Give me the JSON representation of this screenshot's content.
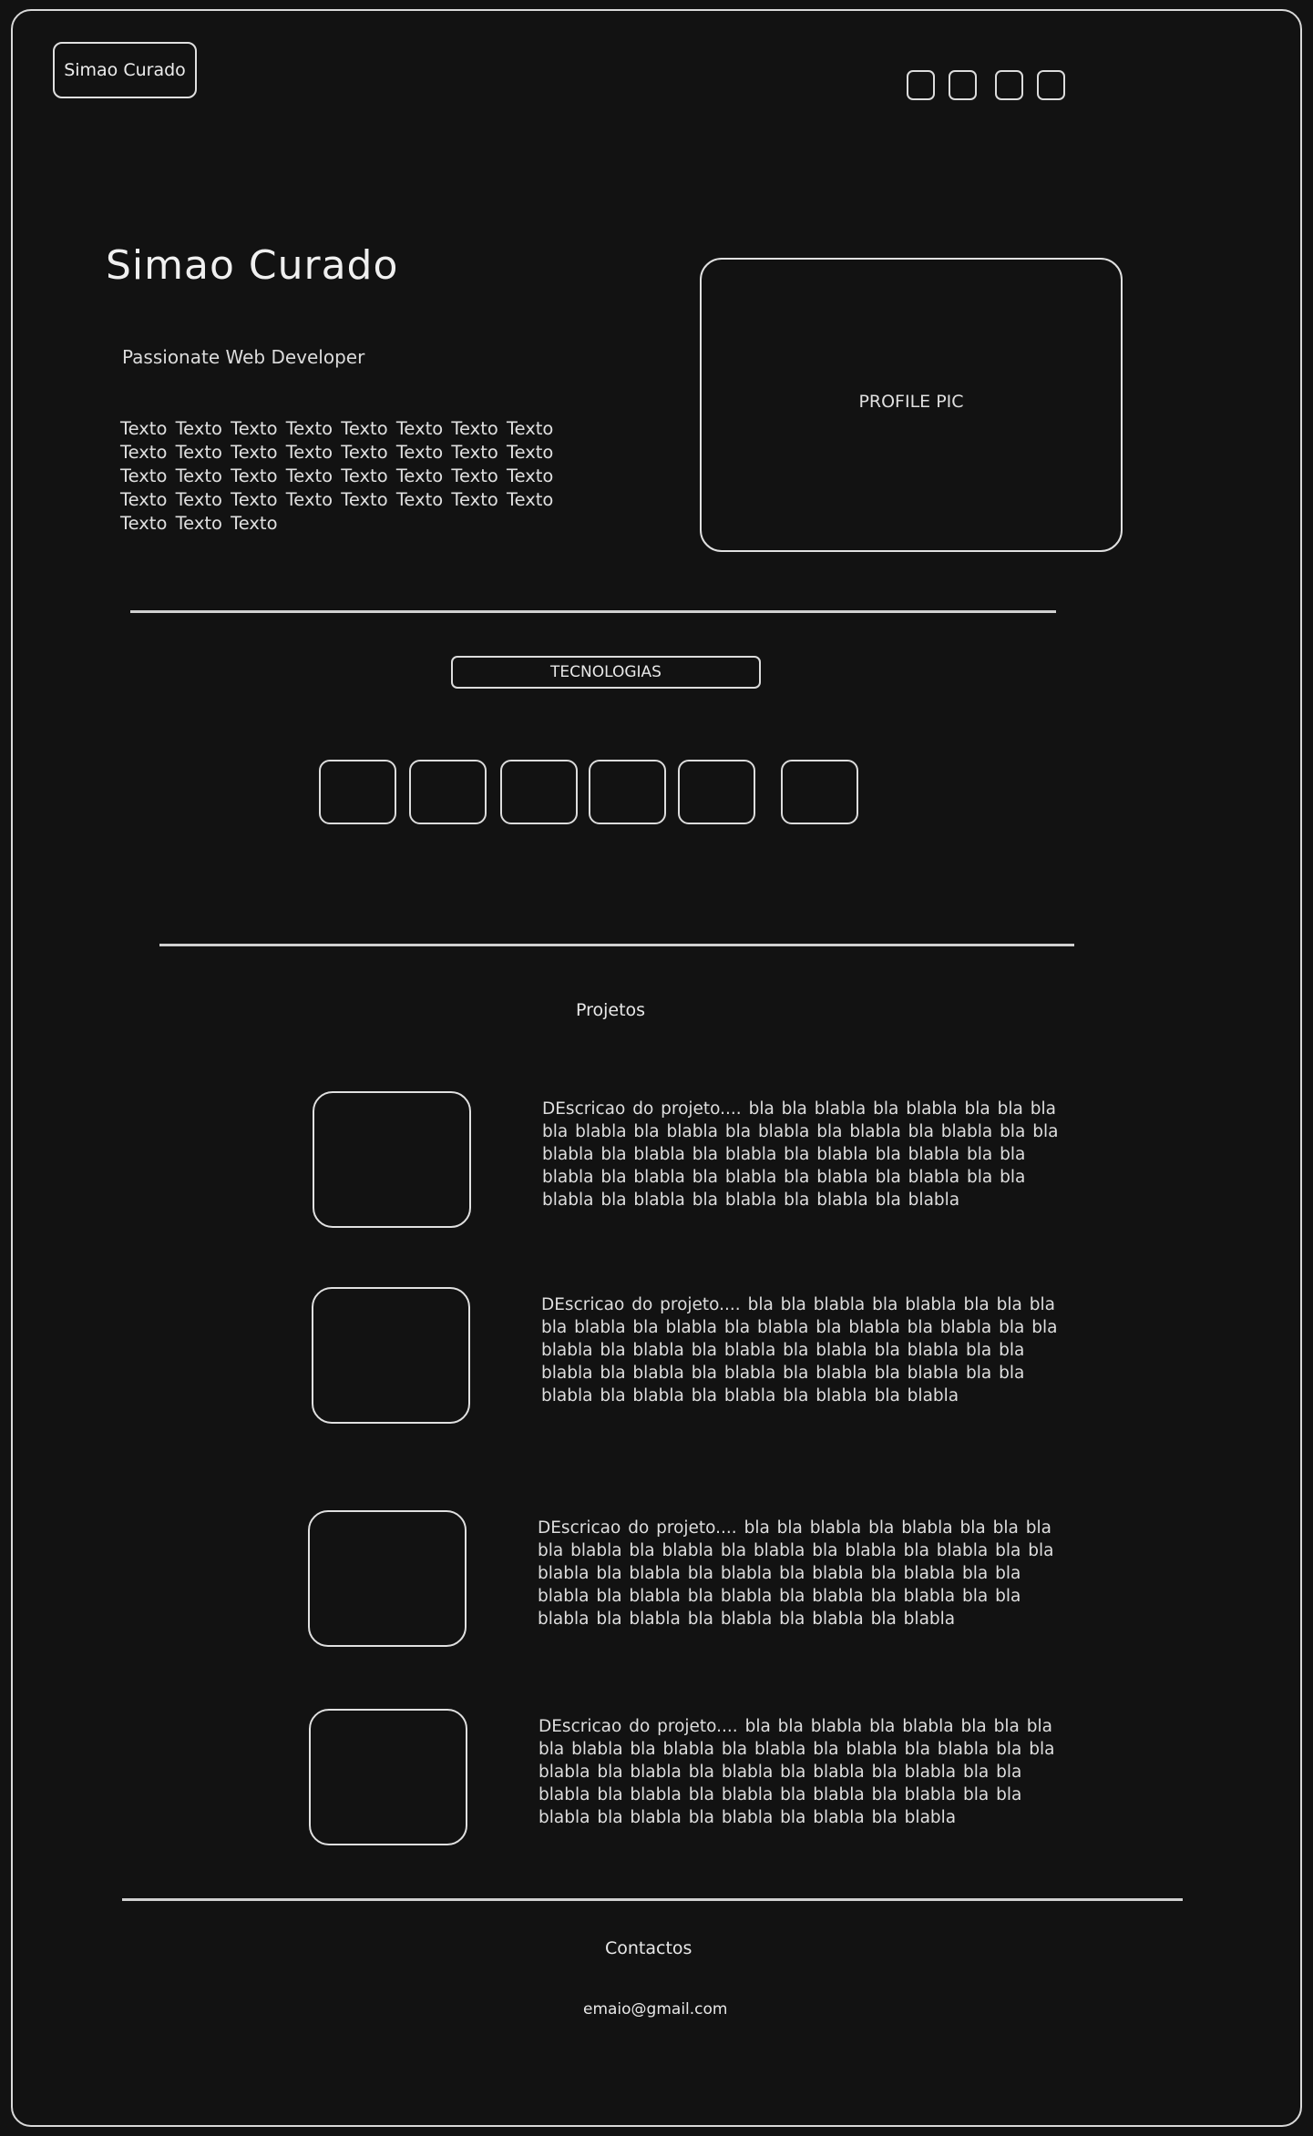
{
  "header": {
    "logo_label": "Simao Curado",
    "nav_icons": [
      "nav-icon-1",
      "nav-icon-2",
      "nav-icon-3",
      "nav-icon-4"
    ]
  },
  "hero": {
    "title": "Simao Curado",
    "subtitle": "Passionate Web Developer",
    "text": "Texto Texto Texto Texto Texto Texto Texto Texto Texto Texto Texto Texto Texto Texto Texto Texto Texto Texto Texto Texto Texto Texto Texto Texto Texto Texto Texto Texto Texto Texto Texto Texto Texto Texto Texto",
    "profile_pic_label": "PROFILE PIC"
  },
  "technologies": {
    "label": "TECNOLOGIAS",
    "icons": [
      "tech-icon-1",
      "tech-icon-2",
      "tech-icon-3",
      "tech-icon-4",
      "tech-icon-5",
      "tech-icon-6"
    ]
  },
  "projects": {
    "title": "Projetos",
    "items": [
      {
        "description": "DEscricao do projeto.... bla bla blabla bla blabla bla bla bla bla blabla bla blabla bla blabla bla blabla bla blabla bla bla blabla bla blabla bla blabla bla blabla bla blabla bla bla blabla bla blabla bla blabla bla blabla bla blabla bla bla blabla bla blabla bla blabla bla blabla bla blabla"
      },
      {
        "description": "DEscricao do projeto.... bla bla blabla bla blabla bla bla bla bla blabla bla blabla bla blabla bla blabla bla blabla bla bla blabla bla blabla bla blabla bla blabla bla blabla bla bla blabla bla blabla bla blabla bla blabla bla blabla bla bla blabla bla blabla bla blabla bla blabla bla blabla"
      },
      {
        "description": "DEscricao do projeto.... bla bla blabla bla blabla bla bla bla bla blabla bla blabla bla blabla bla blabla bla blabla bla bla blabla bla blabla bla blabla bla blabla bla blabla bla bla blabla bla blabla bla blabla bla blabla bla blabla bla bla blabla bla blabla bla blabla bla blabla bla blabla"
      },
      {
        "description": "DEscricao do projeto.... bla bla blabla bla blabla bla bla bla bla blabla bla blabla bla blabla bla blabla bla blabla bla bla blabla bla blabla bla blabla bla blabla bla blabla bla bla blabla bla blabla bla blabla bla blabla bla blabla bla bla blabla bla blabla bla blabla bla blabla bla blabla"
      }
    ]
  },
  "contacts": {
    "title": "Contactos",
    "email": "emaio@gmail.com"
  }
}
